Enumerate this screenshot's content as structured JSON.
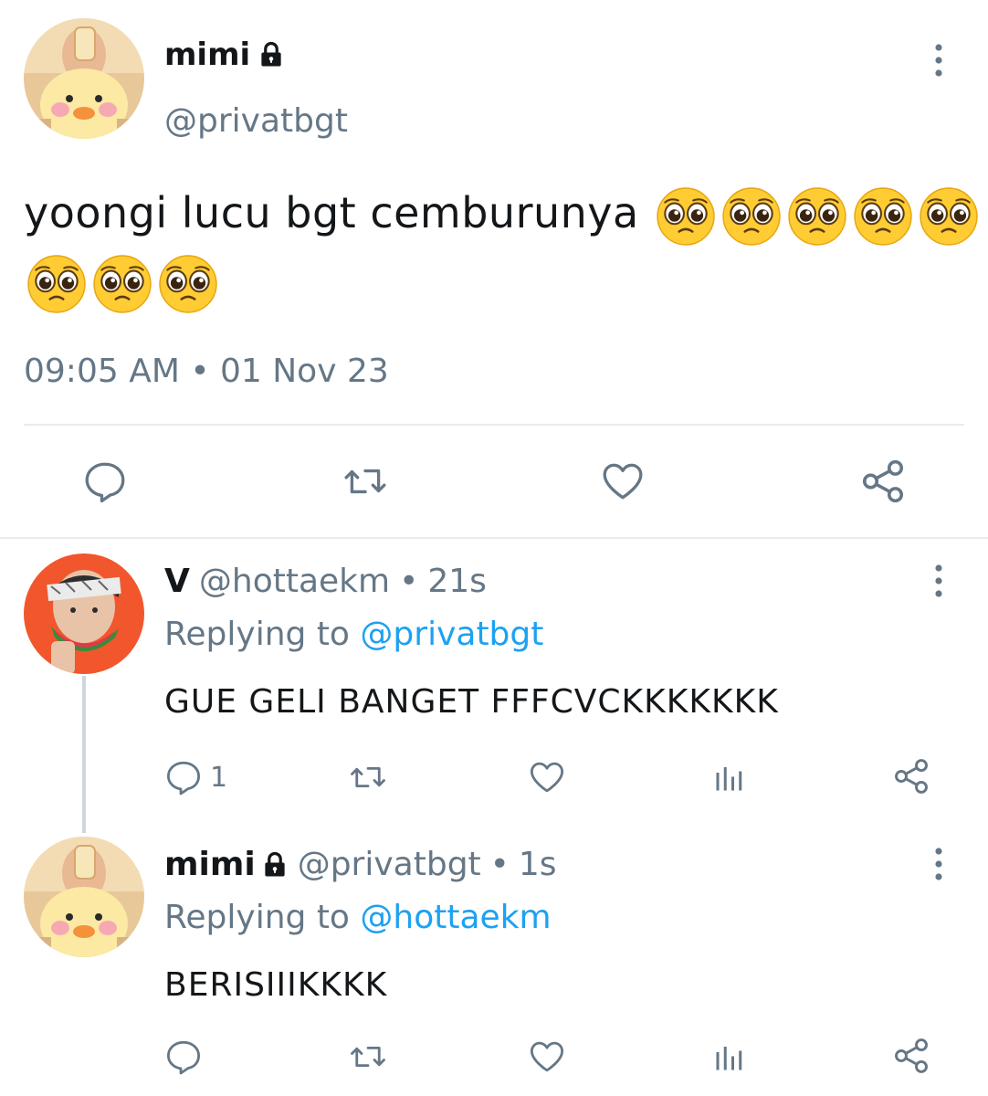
{
  "main_tweet": {
    "display_name": "mimi",
    "handle": "@privatbgt",
    "text": "yoongi lucu bgt cemburunya",
    "emoji_line1_count": 5,
    "emoji_line2_count": 3,
    "timestamp": "09:05 AM • 01 Nov 23",
    "icons": [
      "reply-icon",
      "retweet-icon",
      "like-icon",
      "share-icon",
      "lock-icon",
      "more-options-icon"
    ]
  },
  "replies": [
    {
      "display_name": "V",
      "handle": "@hottaekm",
      "separator": "•",
      "time": "21s",
      "replying_label": "Replying to",
      "replying_to": "@privatbgt",
      "text": "GUE GELI BANGET FFFCVCKKKKKKK",
      "reply_count": "1"
    },
    {
      "display_name": "mimi",
      "handle": "@privatbgt",
      "separator": "•",
      "time": "1s",
      "replying_label": "Replying to",
      "replying_to": "@hottaekm",
      "text": "BERISIIIKKKK",
      "reply_count": ""
    }
  ],
  "colors": {
    "primary_text": "#14171a",
    "secondary_text": "#657786",
    "link": "#1da1f2",
    "divider": "#e6ecf0"
  }
}
